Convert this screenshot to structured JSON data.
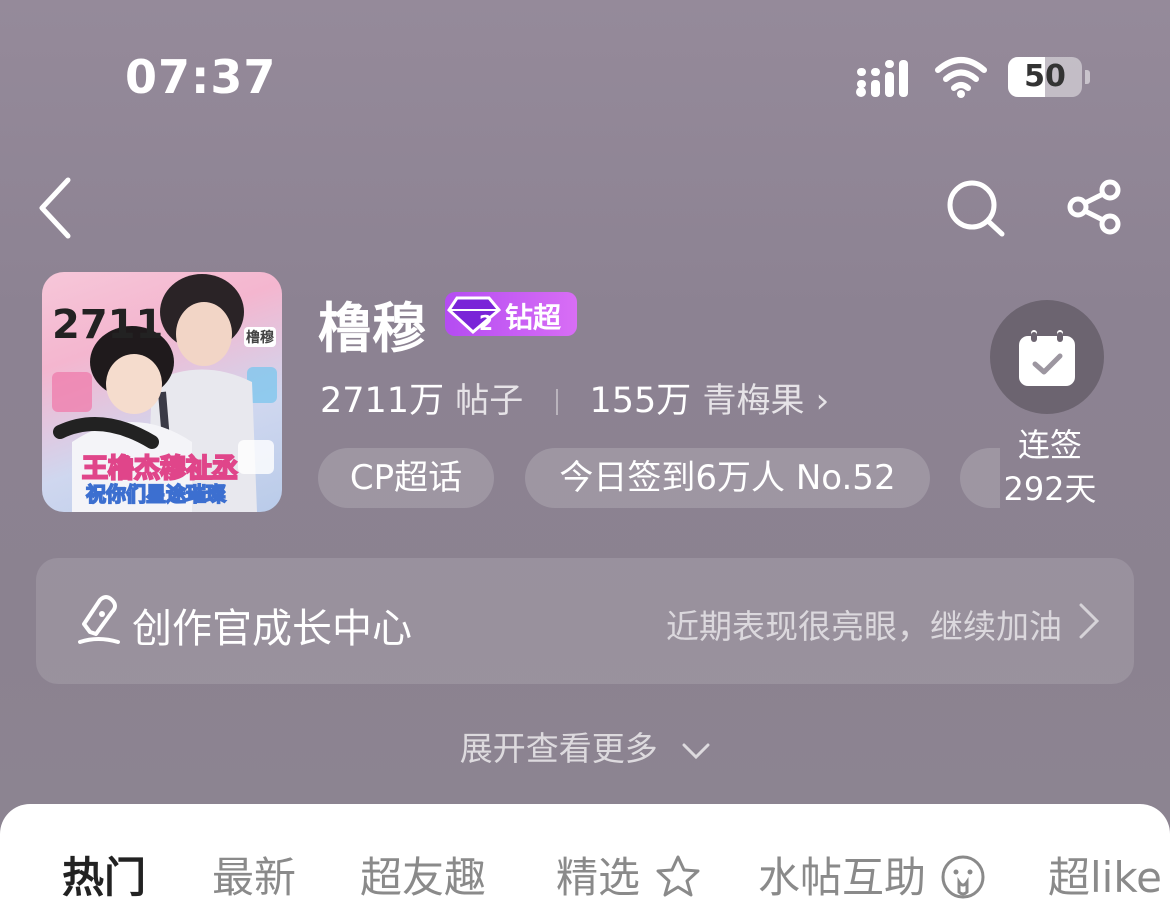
{
  "status_bar": {
    "time": "07:37",
    "battery": "50",
    "battery_level": 0.5
  },
  "topic": {
    "name": "橹穆",
    "badge_label": "钻超",
    "badge_level": "2",
    "posts_count": "2711万",
    "posts_label": "帖子",
    "fans_count": "155万",
    "fans_label": "青梅果",
    "cover_text": {
      "number": "2711",
      "line1": "王橹杰穆祉丞",
      "line2": "祝你们星途璀璨",
      "name_tag": "橹穆"
    }
  },
  "chips": [
    "CP超话",
    "今日签到6万人 No.52"
  ],
  "checkin": {
    "label": "连签",
    "days": "292天"
  },
  "growth": {
    "label": "创作官成长中心",
    "hint": "近期表现很亮眼，继续加油"
  },
  "expand_label": "展开查看更多",
  "tabs": [
    "热门",
    "最新",
    "超友趣",
    "精选",
    "水帖互助",
    "超like"
  ],
  "colors": {
    "badge": "#c45cf4",
    "background": "#8f8594",
    "active_tab": "#222222"
  }
}
